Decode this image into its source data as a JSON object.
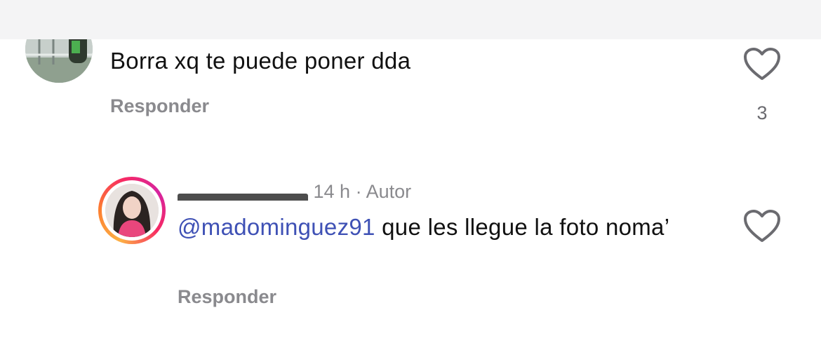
{
  "comment_1": {
    "text": "Borra xq te puede poner dda",
    "reply_label": "Responder",
    "like_count": "3",
    "like_icon": "heart-outline-icon"
  },
  "comment_2": {
    "time": "14 h",
    "separator": "·",
    "author_tag": "Autor",
    "mention": "@madominguez91",
    "text": " que les llegue la foto noma’",
    "reply_label": "Responder",
    "like_icon": "heart-outline-icon"
  },
  "colors": {
    "text": "#111111",
    "secondary": "#8a8a8e",
    "mention": "#3f51b5",
    "story_ring_start": "#fcb045",
    "story_ring_end": "#d6249f"
  }
}
